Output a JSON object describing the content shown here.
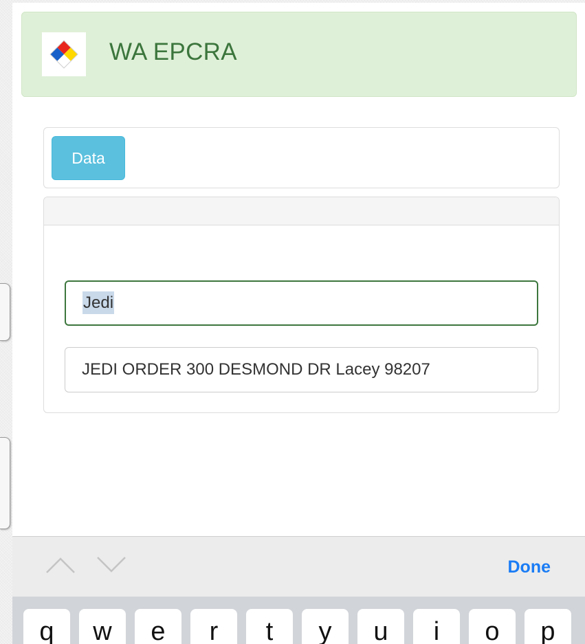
{
  "header": {
    "brand": "WA EPCRA",
    "logo_icon": "nfpa-diamond-icon",
    "bg_color": "#dff0d8",
    "text_color": "#3c763d"
  },
  "tabs": {
    "data_label": "Data",
    "button_color": "#5bc0de"
  },
  "form": {
    "search_value": "Jedi",
    "result_value": "JEDI ORDER 300 DESMOND DR Lacey 98207"
  },
  "keyboard_accessory": {
    "prev_icon": "chevron-up-icon",
    "next_icon": "chevron-down-icon",
    "done_label": "Done",
    "done_color": "#1a7cf5"
  },
  "keyboard": {
    "keys": [
      "q",
      "w",
      "e",
      "r",
      "t",
      "y",
      "u",
      "i",
      "o",
      "p"
    ]
  }
}
